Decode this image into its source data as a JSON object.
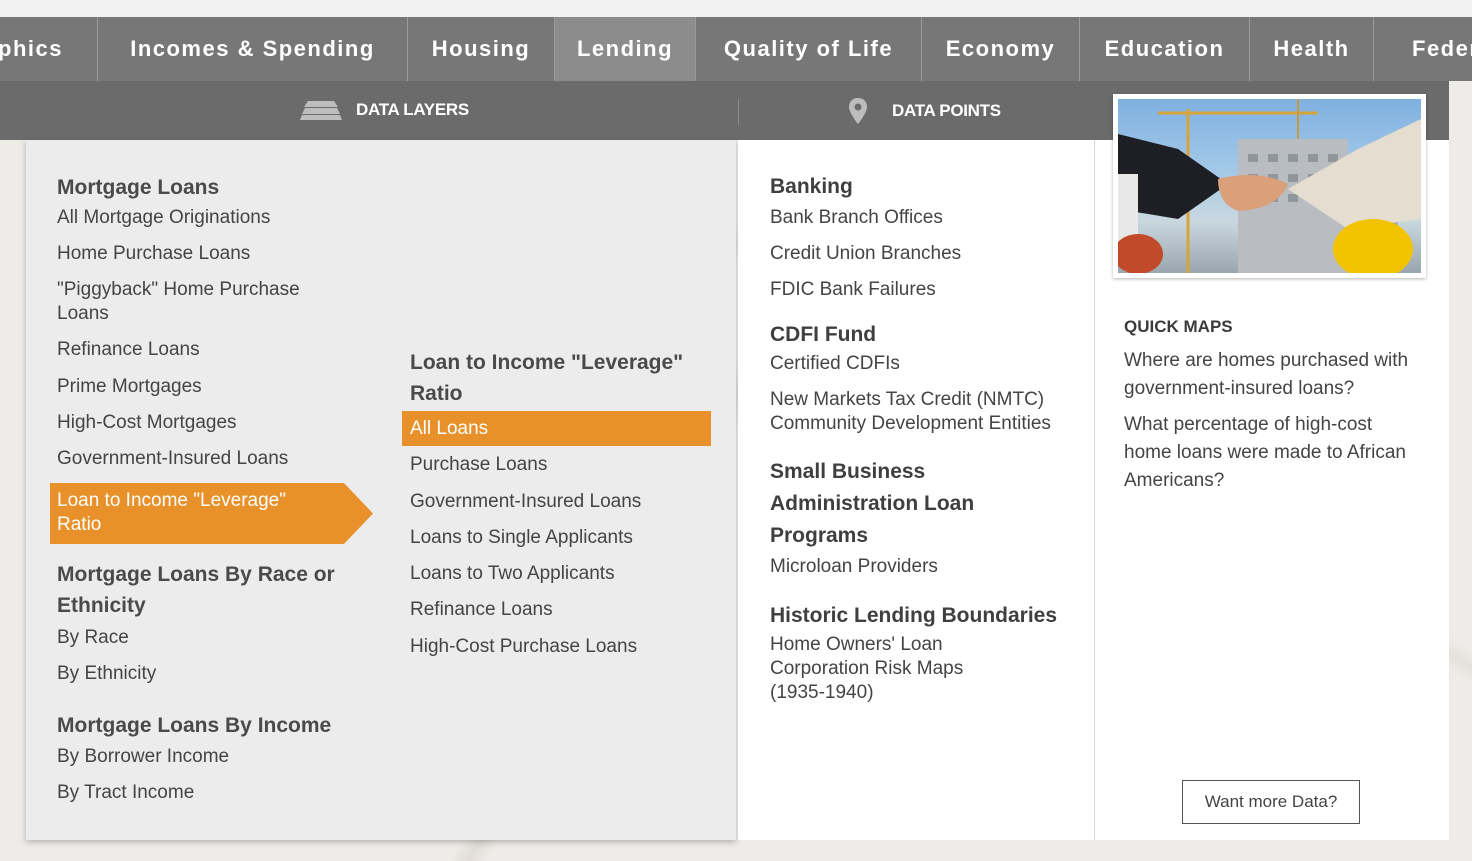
{
  "nav": {
    "tabs": [
      {
        "label": "phics",
        "width": 98
      },
      {
        "label": "Incomes & Spending",
        "width": 310
      },
      {
        "label": "Housing",
        "width": 147
      },
      {
        "label": "Lending",
        "width": 141,
        "active": true
      },
      {
        "label": "Quality of Life",
        "width": 226
      },
      {
        "label": "Economy",
        "width": 158
      },
      {
        "label": "Education",
        "width": 170
      },
      {
        "label": "Health",
        "width": 124
      },
      {
        "label": "Feder",
        "width": 98
      }
    ]
  },
  "subnav": {
    "data_layers": "DATA LAYERS",
    "data_points": "DATA POINTS"
  },
  "layers_col1": {
    "mortgage_heading": "Mortgage Loans",
    "mortgage_items": [
      "All Mortgage Originations",
      "Home Purchase Loans",
      "\"Piggyback\" Home Purchase Loans",
      "Refinance Loans",
      "Prime Mortgages",
      "High-Cost Mortgages",
      "Government-Insured Loans"
    ],
    "selected": "Loan to Income \"Leverage\" Ratio",
    "race_heading": "Mortgage Loans By Race or Ethnicity",
    "race_items": [
      "By Race",
      "By Ethnicity"
    ],
    "income_heading": "Mortgage Loans By Income",
    "income_items": [
      "By Borrower Income",
      "By Tract Income"
    ]
  },
  "layers_col2": {
    "heading": "Loan to Income \"Leverage\" Ratio",
    "selected": "All Loans",
    "items": [
      "Purchase Loans",
      "Government-Insured Loans",
      "Loans to Single Applicants",
      "Loans to Two Applicants",
      "Refinance Loans",
      "High-Cost Purchase Loans"
    ]
  },
  "points": {
    "banking_heading": "Banking",
    "banking_items": [
      "Bank Branch Offices",
      "Credit Union Branches",
      "FDIC Bank Failures"
    ],
    "cdfi_heading": "CDFI Fund",
    "cdfi_items": [
      "Certified CDFIs",
      "New Markets Tax Credit (NMTC) Community Development Entities"
    ],
    "sba_heading": "Small Business Administration Loan Programs",
    "sba_items": [
      "Microloan Providers"
    ],
    "historic_heading": "Historic Lending Boundaries",
    "historic_items": [
      "Home Owners' Loan Corporation Risk Maps (1935-1940)"
    ]
  },
  "quick": {
    "title": "QUICK MAPS",
    "links": [
      "Where are homes purchased with government-insured loans?",
      "What percentage of high-cost home loans were made to African Americans?"
    ],
    "more_button": "Want more Data?"
  },
  "colors": {
    "accent": "#e8912a",
    "nav": "#777777",
    "subnav": "#6b6b6b"
  }
}
